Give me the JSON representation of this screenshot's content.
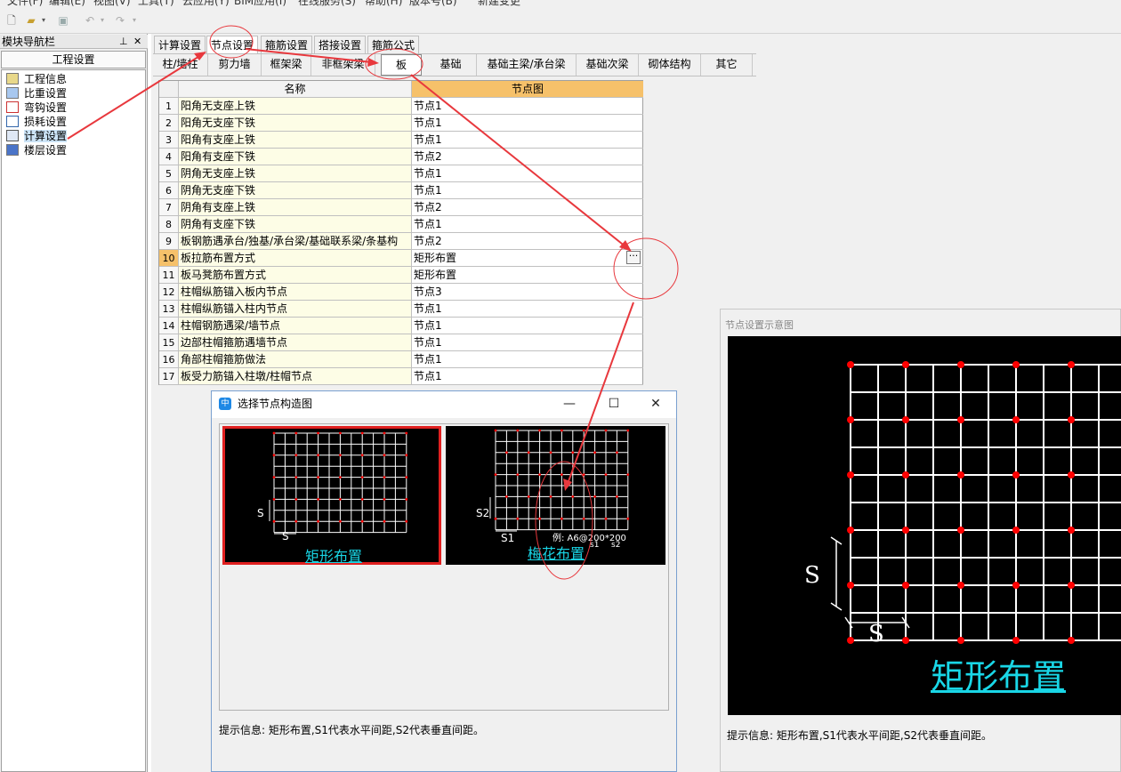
{
  "menu": [
    "文件(F)",
    "编辑(E)",
    "视图(V)",
    "工具(T)",
    "云应用(Y)",
    "BIM应用(I)",
    "在线服务(S)",
    "帮助(H)",
    "版本号(B)",
    "新建变更"
  ],
  "nav": {
    "title": "模块导航栏",
    "header": "工程设置",
    "items": [
      {
        "label": "工程信息",
        "icon": "folder-info-icon"
      },
      {
        "label": "比重设置",
        "icon": "weight-icon"
      },
      {
        "label": "弯钩设置",
        "icon": "hook-icon"
      },
      {
        "label": "损耗设置",
        "icon": "loss-icon"
      },
      {
        "label": "计算设置",
        "icon": "calc-icon"
      },
      {
        "label": "楼层设置",
        "icon": "floor-icon"
      }
    ]
  },
  "tabs": [
    "计算设置",
    "节点设置",
    "箍筋设置",
    "搭接设置",
    "箍筋公式"
  ],
  "active_tab": "节点设置",
  "subtabs": [
    "柱/墙柱",
    "剪力墙",
    "框架梁",
    "非框架梁",
    "板",
    "基础",
    "基础主梁/承台梁",
    "基础次梁",
    "砌体结构",
    "其它"
  ],
  "active_subtab": "板",
  "grid": {
    "headers": [
      "名称",
      "节点图"
    ],
    "rows": [
      {
        "n": "1",
        "name": "阳角无支座上铁",
        "val": "节点1"
      },
      {
        "n": "2",
        "name": "阳角无支座下铁",
        "val": "节点1"
      },
      {
        "n": "3",
        "name": "阳角有支座上铁",
        "val": "节点1"
      },
      {
        "n": "4",
        "name": "阳角有支座下铁",
        "val": "节点2"
      },
      {
        "n": "5",
        "name": "阴角无支座上铁",
        "val": "节点1"
      },
      {
        "n": "6",
        "name": "阴角无支座下铁",
        "val": "节点1"
      },
      {
        "n": "7",
        "name": "阴角有支座上铁",
        "val": "节点2"
      },
      {
        "n": "8",
        "name": "阴角有支座下铁",
        "val": "节点1"
      },
      {
        "n": "9",
        "name": "板钢筋遇承台/独基/承台梁/基础联系梁/条基构",
        "val": "节点2"
      },
      {
        "n": "10",
        "name": "板拉筋布置方式",
        "val": "矩形布置"
      },
      {
        "n": "11",
        "name": "板马凳筋布置方式",
        "val": "矩形布置"
      },
      {
        "n": "12",
        "name": "柱帽纵筋锚入板内节点",
        "val": "节点3"
      },
      {
        "n": "13",
        "name": "柱帽纵筋锚入柱内节点",
        "val": "节点1"
      },
      {
        "n": "14",
        "name": "柱帽钢筋遇梁/墙节点",
        "val": "节点1"
      },
      {
        "n": "15",
        "name": "边部柱帽箍筋遇墙节点",
        "val": "节点1"
      },
      {
        "n": "16",
        "name": "角部柱帽箍筋做法",
        "val": "节点1"
      },
      {
        "n": "17",
        "name": "板受力筋锚入柱墩/柱帽节点",
        "val": "节点1"
      }
    ],
    "ellipsis": "···"
  },
  "dialog": {
    "title": "选择节点构造图",
    "icon_text": "中",
    "min": "—",
    "max": "☐",
    "close": "✕",
    "option1": {
      "caption": "矩形布置",
      "s_label": "S",
      "s_vert": "S"
    },
    "option2": {
      "caption": "梅花布置",
      "s1": "S1",
      "s2": "S2",
      "example": "例: A6@200*200",
      "ex_s1": "s1",
      "ex_s2": "s2"
    },
    "hint": "提示信息:  矩形布置,S1代表水平间距,S2代表垂直间距。"
  },
  "preview": {
    "title": "节点设置示意图",
    "caption": "矩形布置",
    "s_h": "S",
    "s_v": "S",
    "hint": "提示信息:  矩形布置,S1代表水平间距,S2代表垂直间距。"
  },
  "colors": {
    "annotation": "#e8383d",
    "caption": "#19d6e6",
    "header_yellow": "#f6c16a",
    "grid_line": "#ffffff",
    "dot": "#ff0000"
  }
}
